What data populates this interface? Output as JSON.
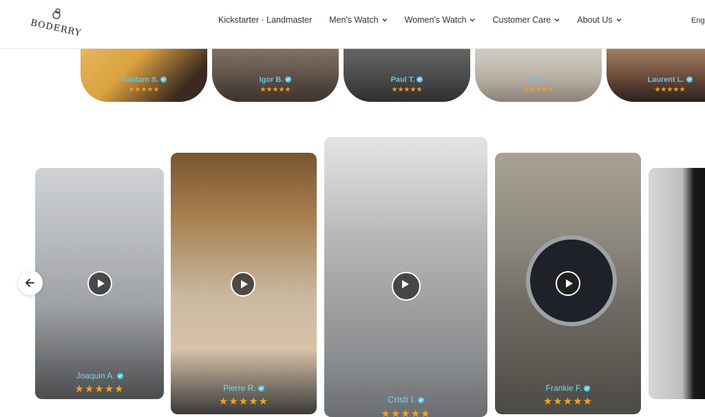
{
  "brand": {
    "logo_text": "BODERRY"
  },
  "nav": {
    "items": [
      {
        "label": "Kickstarter · Landmaster",
        "has_dropdown": false
      },
      {
        "label": "Men's Watch",
        "has_dropdown": true
      },
      {
        "label": "Women's Watch",
        "has_dropdown": true
      },
      {
        "label": "Customer Care",
        "has_dropdown": true
      },
      {
        "label": "About Us",
        "has_dropdown": true
      }
    ],
    "language": "Eng"
  },
  "reviews": [
    {
      "name": "Gautam S.",
      "stars": "★★★★★"
    },
    {
      "name": "Igor B.",
      "stars": "★★★★★"
    },
    {
      "name": "Paul T.",
      "stars": "★★★★★"
    },
    {
      "name": "PI 3.",
      "stars": "★★★★★"
    },
    {
      "name": "Laurent L.",
      "stars": "★★★★★"
    }
  ],
  "videos": [
    {
      "name": "Joaquin A.",
      "stars": "★★★★★"
    },
    {
      "name": "Pierre R.",
      "stars": "★★★★★"
    },
    {
      "name": "Cristi I.",
      "stars": "★★★★★"
    },
    {
      "name": "Frankie F.",
      "stars": "★★★★★"
    }
  ],
  "colors": {
    "accent": "#5bc8e8",
    "star": "#f4a020"
  }
}
